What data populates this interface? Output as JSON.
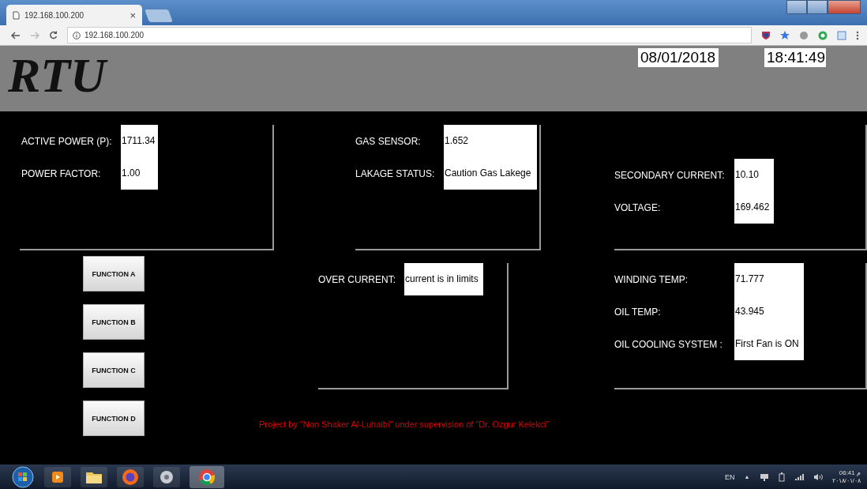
{
  "browser": {
    "tab": {
      "title": "192.168.100.200",
      "close": "×"
    },
    "address": "192.168.100.200"
  },
  "header": {
    "logo": "RTU",
    "date": "08/01/2018",
    "time": "18:41:49"
  },
  "panels": [
    {
      "fields": [
        {
          "label": "ACTIVE POWER (P):",
          "value": "1711.34"
        },
        {
          "label": "POWER FACTOR:",
          "value": "1.00"
        }
      ]
    },
    {
      "fields": [
        {
          "label": "GAS SENSOR:",
          "value": "1.652"
        },
        {
          "label": "LAKAGE STATUS:",
          "value": "Caution Gas Lakege"
        }
      ]
    },
    {
      "fields": [
        {
          "label": "SECONDARY CURRENT:",
          "value": "10.10"
        },
        {
          "label": "VOLTAGE:",
          "value": "169.462"
        }
      ]
    },
    {
      "fields": [
        {
          "label": "OVER CURRENT:",
          "value": "current is in limits"
        }
      ]
    },
    {
      "fields": [
        {
          "label": "WINDING TEMP:",
          "value": "71.777"
        },
        {
          "label": "OIL TEMP:",
          "value": "43.945"
        },
        {
          "label": "OIL COOLING SYSTEM :",
          "value": "First Fan is ON"
        }
      ]
    }
  ],
  "functions": [
    "FUNCTION A",
    "FUNCTION B",
    "FUNCTION C",
    "FUNCTION D"
  ],
  "footer": "Project by \"Non Shaker Al-Luhaibi\" under supervision of \"Dr. Ozgur Kelekci\"",
  "taskbar": {
    "language": "EN",
    "tray_arrow": "▲",
    "clock_time": "06:41 م",
    "clock_date": "٢٠١٨/٠١/٠٨"
  }
}
